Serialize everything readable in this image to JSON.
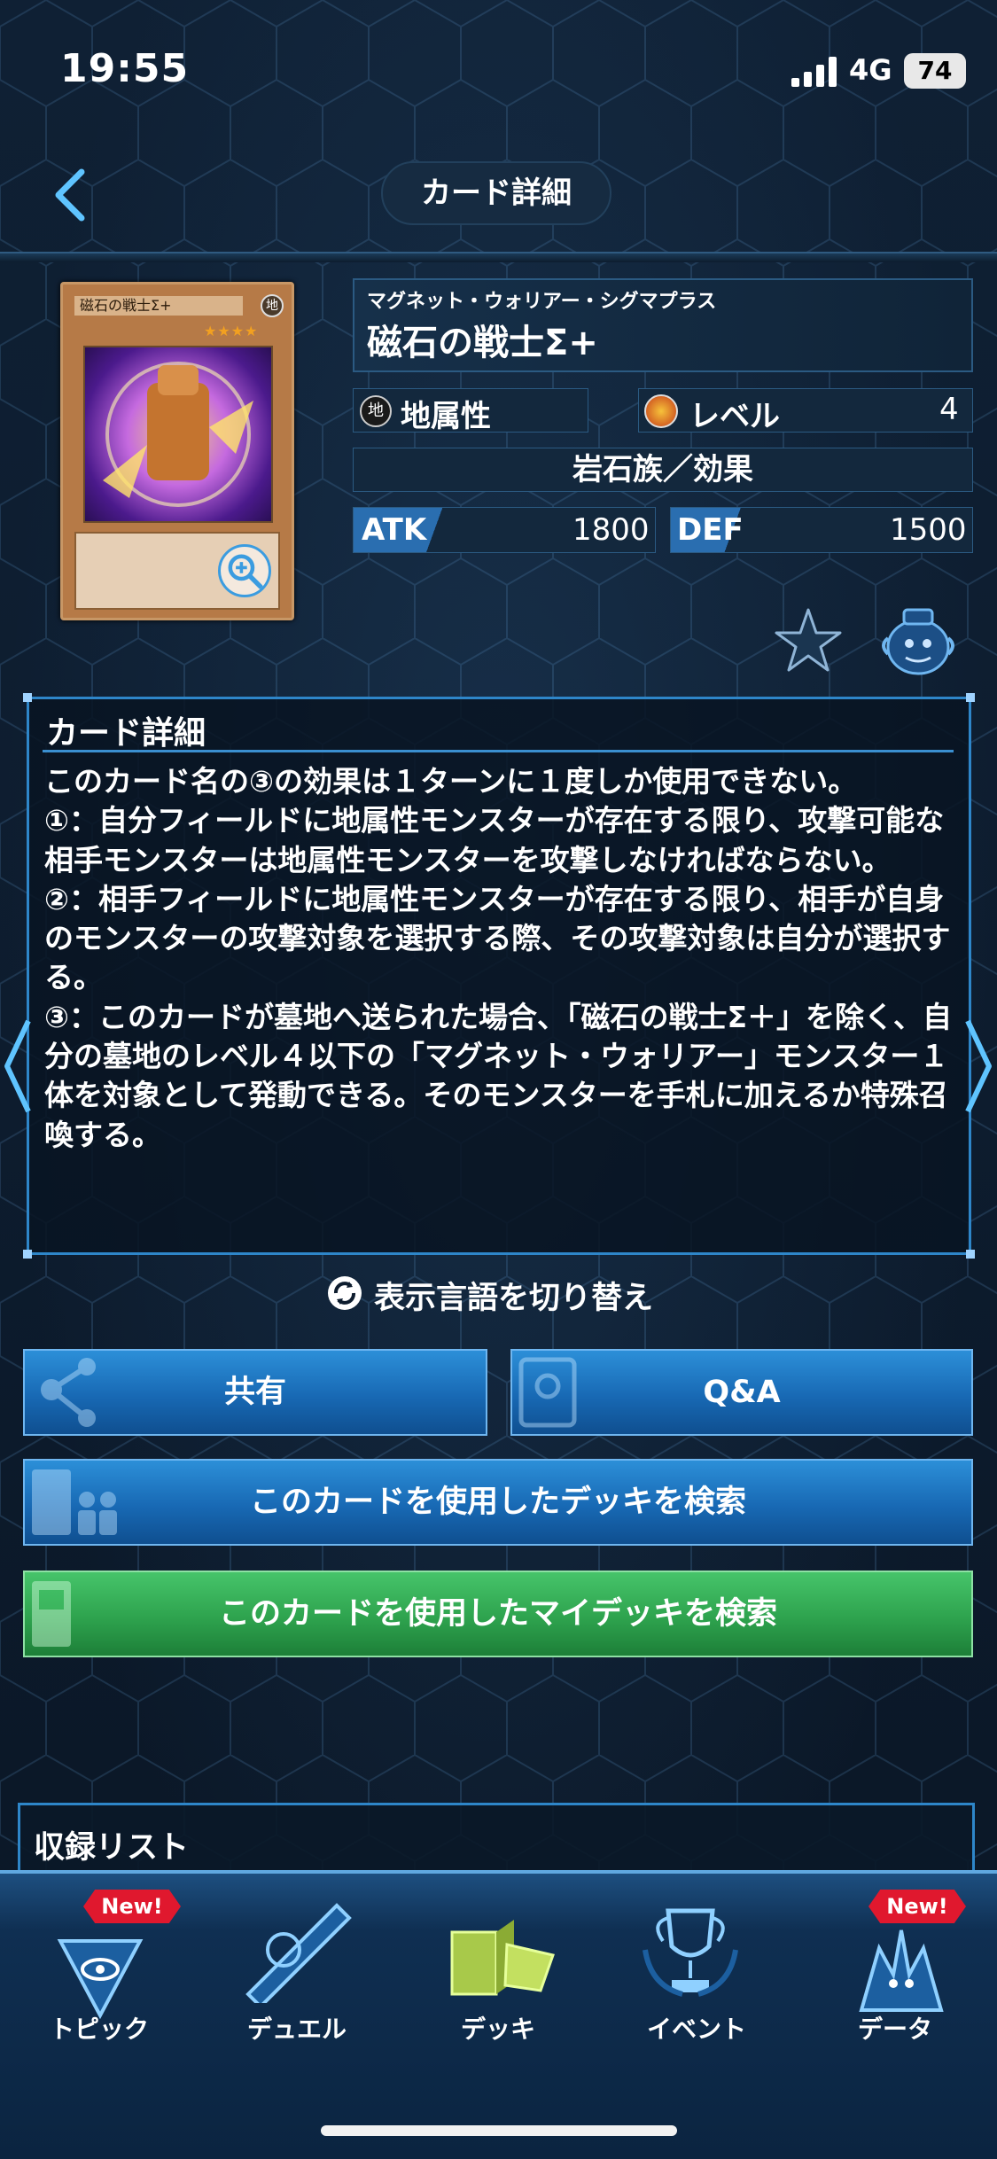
{
  "status_bar": {
    "time": "19:55",
    "network": "4G",
    "battery": "74"
  },
  "header": {
    "title": "カード詳細"
  },
  "card": {
    "art_name": "磁石の戦士Σ+",
    "art_attribute": "地",
    "art_level_stars": "★★★★",
    "ruby": "マグネット・ウォリアー・シグマプラス",
    "name": "磁石の戦士Σ+",
    "attribute_icon": "地",
    "attribute": "地属性",
    "level_label": "レベル",
    "level": "4",
    "type": "岩石族／効果",
    "atk_label": "ATK",
    "atk": "1800",
    "def_label": "DEF",
    "def": "1500"
  },
  "detail": {
    "title": "カード詳細",
    "text": "このカード名の③の効果は１ターンに１度しか使用できない。\n①：自分フィールドに地属性モンスターが存在する限り、攻撃可能な相手モンスターは地属性モンスターを攻撃しなければならない。\n②：相手フィールドに地属性モンスターが存在する限り、相手が自身のモンスターの攻撃対象を選択する際、その攻撃対象は自分が選択する。\n③：このカードが墓地へ送られた場合、「磁石の戦士Σ＋」を除く、自分の墓地のレベル４以下の「マグネット・ウォリアー」モンスター１体を対象として発動できる。そのモンスターを手札に加えるか特殊召喚する。"
  },
  "language_toggle": "表示言語を切り替え",
  "buttons": {
    "share": "共有",
    "qa": "Q&A",
    "deck_search": "このカードを使用したデッキを検索",
    "my_deck_search": "このカードを使用したマイデッキを検索"
  },
  "list": {
    "title": "収録リスト"
  },
  "nav": {
    "items": [
      {
        "label": "トピック",
        "badge": "New!"
      },
      {
        "label": "デュエル"
      },
      {
        "label": "デッキ"
      },
      {
        "label": "イベント"
      },
      {
        "label": "データ",
        "badge": "New!"
      }
    ]
  },
  "colors": {
    "accent_blue": "#2e86c9",
    "button_blue": "#1869b4",
    "button_green": "#2ea34e",
    "badge_red": "#e0182e"
  }
}
